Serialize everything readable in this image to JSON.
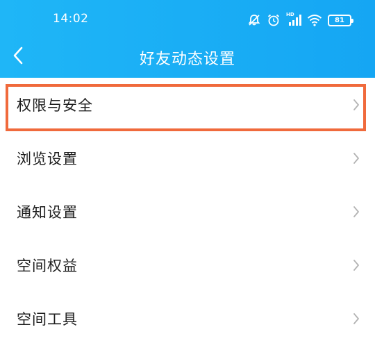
{
  "status": {
    "time": "14:02",
    "network_label": "HD",
    "battery": "81"
  },
  "nav": {
    "title": "好友动态设置"
  },
  "menu": {
    "items": [
      {
        "label": "权限与安全"
      },
      {
        "label": "浏览设置"
      },
      {
        "label": "通知设置"
      },
      {
        "label": "空间权益"
      },
      {
        "label": "空间工具"
      }
    ]
  },
  "colors": {
    "header": "#15a6f3",
    "highlight": "#f06a3c",
    "chevron": "#b3b3b3",
    "text": "#1e1e1e"
  },
  "icons": {
    "back": "back-arrow-icon",
    "chevron": "chevron-right-icon",
    "mute": "mute-bell-icon",
    "alarm": "alarm-icon",
    "signal": "signal-icon",
    "wifi": "wifi-icon",
    "battery": "battery-icon"
  }
}
